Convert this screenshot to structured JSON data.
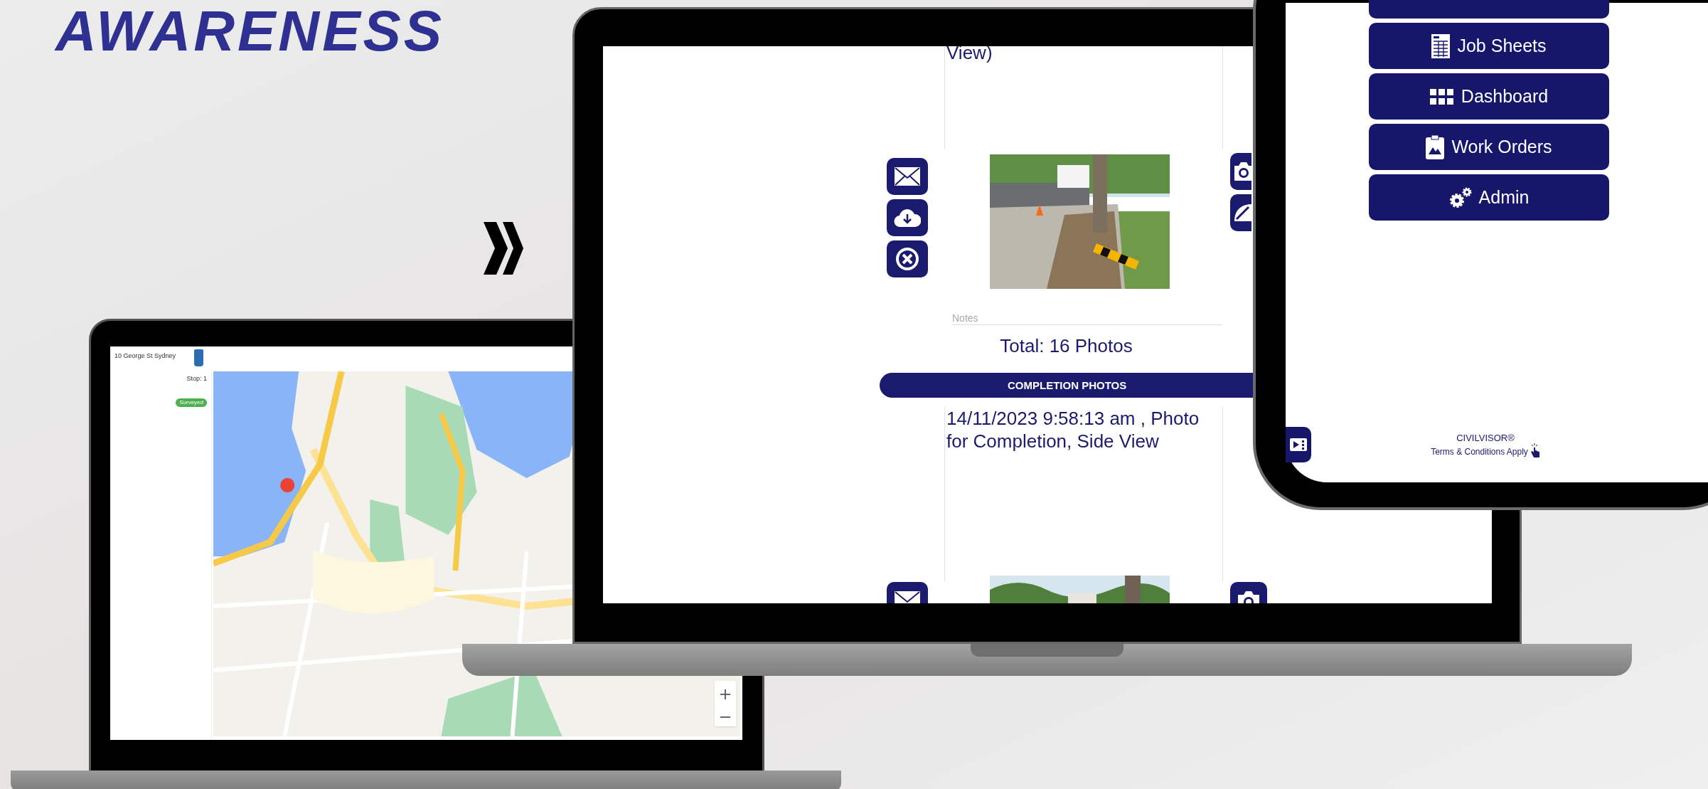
{
  "headline": "AWARENESS",
  "map_laptop": {
    "address": "10 George St Sydney",
    "stop": "Stop: 1",
    "status": "Surveyed"
  },
  "photo_laptop": {
    "caption_top": "View)",
    "notes_placeholder": "Notes",
    "total": "Total: 16 Photos",
    "section_title": "COMPLETION PHOTOS",
    "caption": "14/11/2023 9:58:13 am , Photo for Completion, Side View"
  },
  "phone": {
    "menu": [
      {
        "label": "Job Sheets"
      },
      {
        "label": "Dashboard"
      },
      {
        "label": "Work Orders"
      },
      {
        "label": "Admin"
      }
    ],
    "brand": "CIVILVISOR®",
    "terms": "Terms & Conditions Apply"
  }
}
